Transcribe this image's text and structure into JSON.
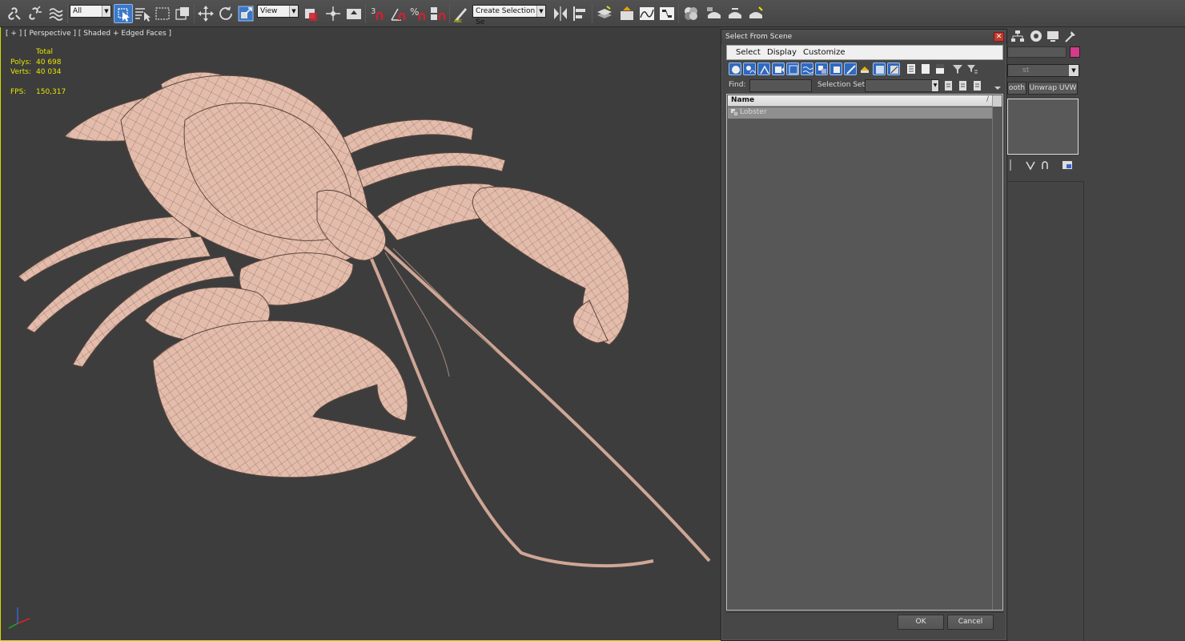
{
  "toolbar": {
    "filter_value": "All",
    "coord_value": "View",
    "named_selection_placeholder": "Create Selection Se"
  },
  "viewport": {
    "label": "[ + ] [ Perspective ] [ Shaded + Edged Faces ]",
    "stats": {
      "total_label": "Total",
      "polys_label": "Polys:",
      "polys_value": "40 698",
      "verts_label": "Verts:",
      "verts_value": "40 034",
      "fps_label": "FPS:",
      "fps_value": "150,317"
    }
  },
  "command_panel": {
    "modifier_list_text": "st",
    "btn_smooth": "ooth",
    "btn_unwrap": "Unwrap UVW",
    "color_swatch": "#d43b8b"
  },
  "dialog": {
    "title": "Select From Scene",
    "menu": {
      "select": "Select",
      "display": "Display",
      "customize": "Customize"
    },
    "find_label": "Find:",
    "find_value": "",
    "selection_set_label": "Selection Set:",
    "list": {
      "column_name": "Name",
      "rows": [
        {
          "name": "Lobster"
        }
      ]
    },
    "ok_label": "OK",
    "cancel_label": "Cancel"
  },
  "colors": {
    "active_tool": "#3b78c8",
    "viewport_border": "#d9d900",
    "stats_text": "#e6e600",
    "mesh": "#e8c2b2"
  }
}
